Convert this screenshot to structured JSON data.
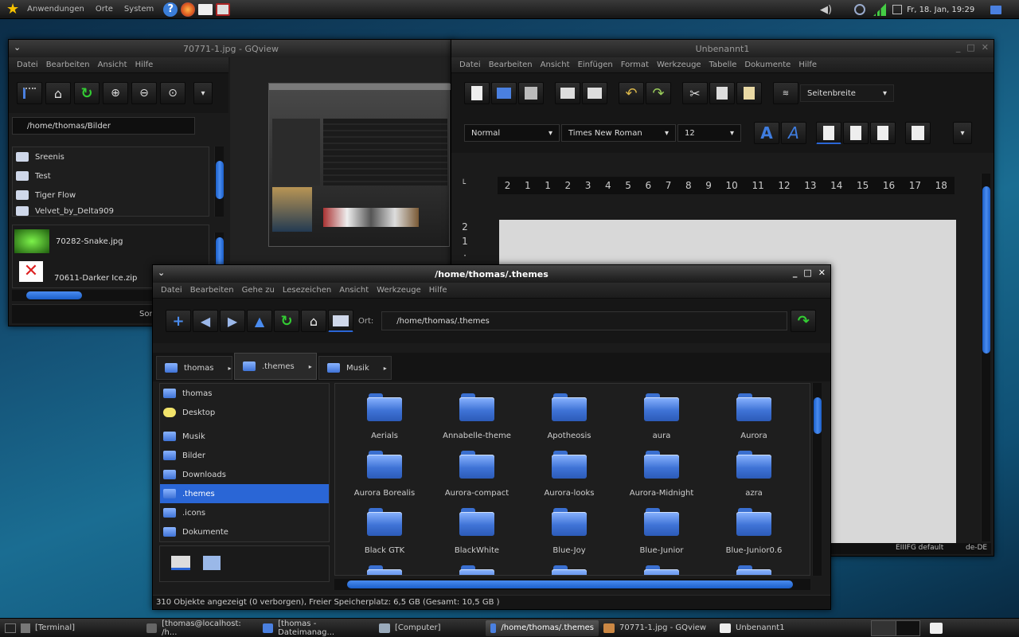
{
  "top_panel": {
    "menus": [
      "Anwendungen",
      "Orte",
      "System"
    ],
    "clock": "Fr, 18. Jan, 19:29"
  },
  "gqview": {
    "title": "70771-1.jpg - GQview",
    "menu": [
      "Datei",
      "Bearbeiten",
      "Ansicht",
      "Hilfe"
    ],
    "path": "/home/thomas/Bilder",
    "folders": [
      "Sreenis",
      "Test",
      "Tiger Flow",
      "Velvet_by_Delta909"
    ],
    "files": [
      "70282-Snake.jpg",
      "70611-Darker Ice.zip"
    ],
    "sort_label": "Sort"
  },
  "writer": {
    "title": "Unbenannt1",
    "menu": [
      "Datei",
      "Bearbeiten",
      "Ansicht",
      "Einfügen",
      "Format",
      "Werkzeuge",
      "Tabelle",
      "Dokumente",
      "Hilfe"
    ],
    "zoom": "Seitenbreite",
    "style": "Normal",
    "font": "Times New Roman",
    "size": "12",
    "ruler": [
      "2",
      "1",
      "1",
      "2",
      "3",
      "4",
      "5",
      "6",
      "7",
      "8",
      "9",
      "10",
      "11",
      "12",
      "13",
      "14",
      "15",
      "16",
      "17",
      "18"
    ],
    "status_layout": "EIIIFG default",
    "status_lang": "de-DE"
  },
  "nautilus": {
    "title": "/home/thomas/.themes",
    "menu": [
      "Datei",
      "Bearbeiten",
      "Gehe zu",
      "Lesezeichen",
      "Ansicht",
      "Werkzeuge",
      "Hilfe"
    ],
    "location_label": "Ort:",
    "location": "/home/thomas/.themes",
    "tabs": [
      "thomas",
      ".themes",
      "Musik"
    ],
    "sidebar": [
      "thomas",
      "Desktop",
      "Musik",
      "Bilder",
      "Downloads",
      ".themes",
      ".icons",
      "Dokumente"
    ],
    "selected_sidebar": ".themes",
    "items": [
      "Aerials",
      "Annabelle-theme",
      "Apotheosis",
      "aura",
      "Aurora",
      "Aurora Borealis",
      "Aurora-compact",
      "Aurora-looks",
      "Aurora-Midnight",
      "azra",
      "Black GTK",
      "BlackWhite",
      "Blue-Joy",
      "Blue-Junior",
      "Blue-Junior0.6"
    ],
    "status": "310 Objekte angezeigt (0 verborgen), Freier Speicherplatz: 6,5 GB (Gesamt: 10,5 GB )"
  },
  "taskbar": {
    "tasks": [
      "[Terminal]",
      "[thomas@localhost: /h...",
      "[thomas - Dateimanag...",
      "[Computer]",
      "/home/thomas/.themes",
      "70771-1.jpg - GQview",
      "Unbenannt1"
    ],
    "active_task": "/home/thomas/.themes"
  },
  "colors": {
    "accent": "#2a66d6",
    "folder": "#4a80e0",
    "panel": "#1b1b1b"
  }
}
